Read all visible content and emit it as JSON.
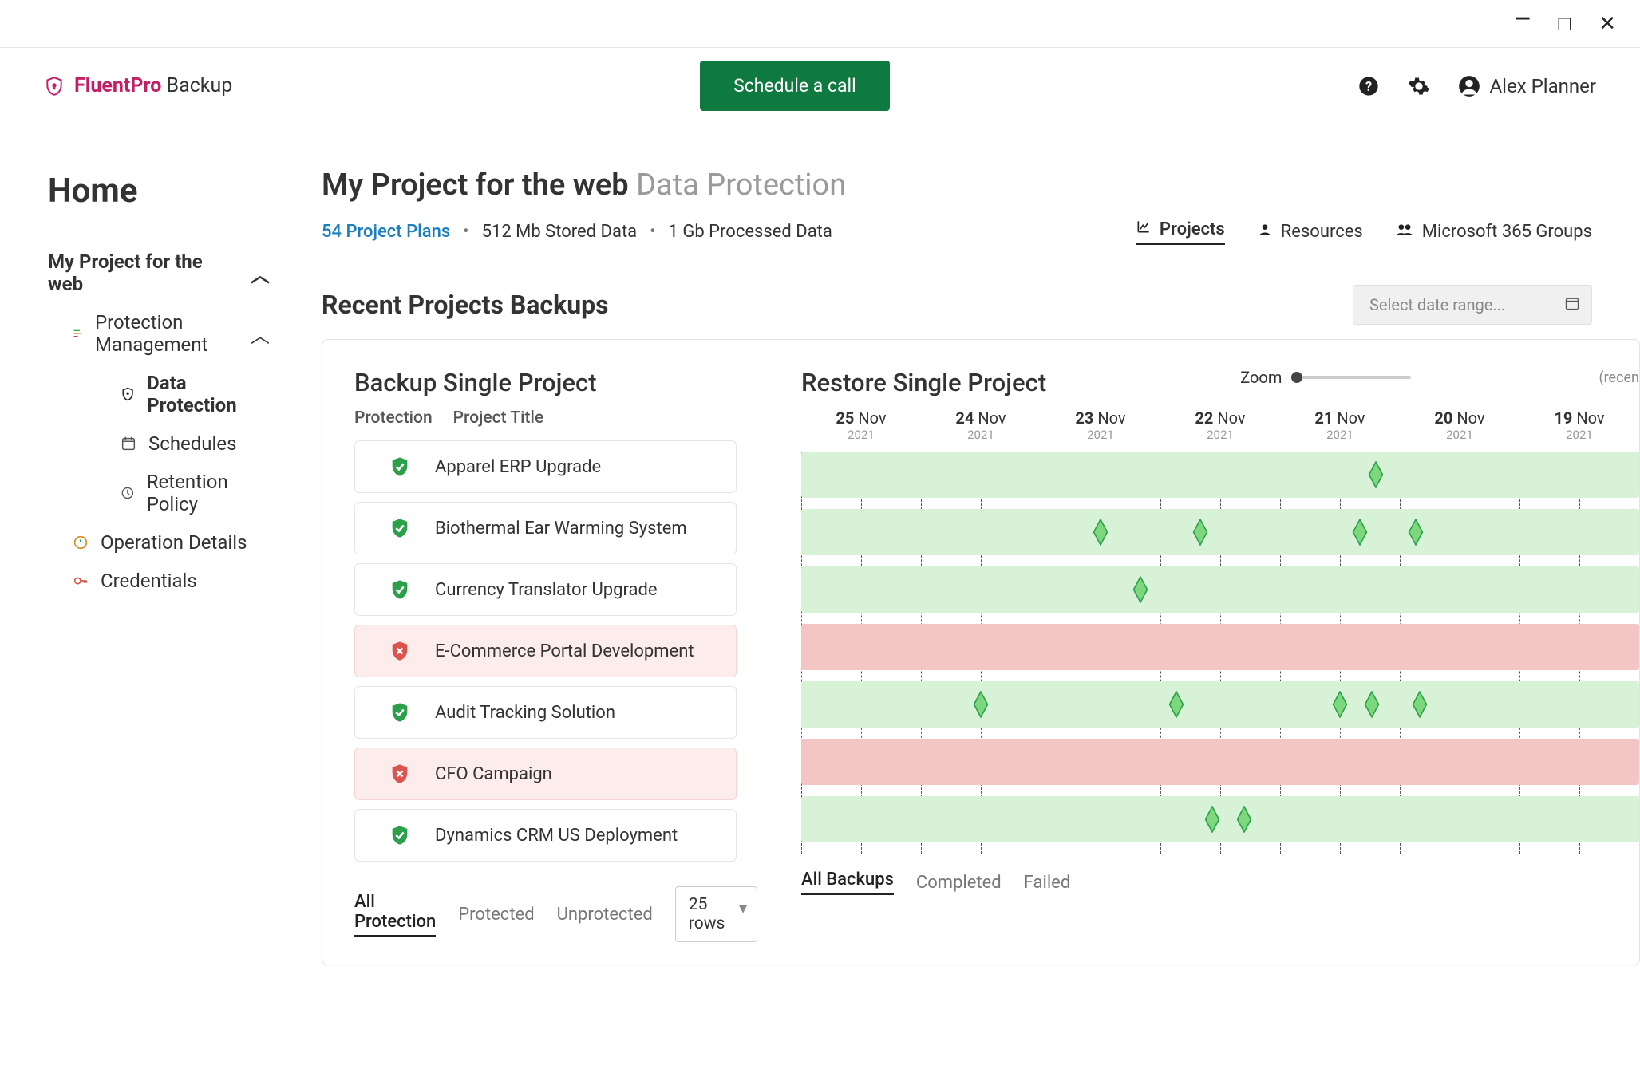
{
  "window": {
    "minimize": "—",
    "maximize": "□",
    "close": "✕"
  },
  "header": {
    "brand_strong": "FluentPro",
    "brand_rest": " Backup",
    "cta": "Schedule a call",
    "user_name": "Alex Planner"
  },
  "sidebar": {
    "title": "Home",
    "root": "My Project for the web",
    "group": "Protection Management",
    "items": {
      "data_protection": "Data Protection",
      "schedules": "Schedules",
      "retention": "Retention Policy",
      "operation": "Operation Details",
      "credentials": "Credentials"
    }
  },
  "page": {
    "title_main": "My Project for the web",
    "title_muted": "Data Protection",
    "plans_link": "54 Project Plans",
    "stat_stored": "512 Mb Stored Data",
    "stat_processed": "1 Gb Processed Data",
    "tabs": {
      "projects": "Projects",
      "resources": "Resources",
      "groups": "Microsoft 365 Groups"
    }
  },
  "section": {
    "title": "Recent Projects Backups",
    "date_placeholder": "Select date range..."
  },
  "left": {
    "title": "Backup Single Project",
    "col_protection": "Protection",
    "col_title": "Project Title",
    "projects": [
      {
        "title": "Apparel ERP Upgrade",
        "status": "ok"
      },
      {
        "title": "Biothermal Ear Warming System",
        "status": "ok"
      },
      {
        "title": "Currency Translator Upgrade",
        "status": "ok"
      },
      {
        "title": "E-Commerce Portal Development",
        "status": "fail"
      },
      {
        "title": "Audit Tracking Solution",
        "status": "ok"
      },
      {
        "title": "CFO Campaign",
        "status": "fail"
      },
      {
        "title": "Dynamics CRM US Deployment",
        "status": "ok"
      }
    ],
    "filters": {
      "all": "All Protection",
      "protected": "Protected",
      "unprotected": "Unprotected",
      "rows": "25 rows"
    }
  },
  "right": {
    "title": "Restore Single Project",
    "zoom": "Zoom",
    "hint": "(recen",
    "dates": [
      {
        "d": "25",
        "m": "Nov",
        "y": "2021"
      },
      {
        "d": "24",
        "m": "Nov",
        "y": "2021"
      },
      {
        "d": "23",
        "m": "Nov",
        "y": "2021"
      },
      {
        "d": "22",
        "m": "Nov",
        "y": "2021"
      },
      {
        "d": "21",
        "m": "Nov",
        "y": "2021"
      },
      {
        "d": "20",
        "m": "Nov",
        "y": "2021"
      },
      {
        "d": "19",
        "m": "Nov",
        "y": "2021"
      }
    ],
    "rows": [
      {
        "status": "ok",
        "diamonds": [
          720
        ]
      },
      {
        "status": "ok",
        "diamonds": [
          375,
          500,
          700,
          770
        ]
      },
      {
        "status": "ok",
        "diamonds": [
          425
        ]
      },
      {
        "status": "fail",
        "diamonds": []
      },
      {
        "status": "ok",
        "diamonds": [
          225,
          470,
          675,
          715,
          775
        ]
      },
      {
        "status": "fail",
        "diamonds": []
      },
      {
        "status": "ok",
        "diamonds": [
          515,
          555
        ]
      }
    ],
    "filters": {
      "all": "All Backups",
      "completed": "Completed",
      "failed": "Failed"
    }
  }
}
